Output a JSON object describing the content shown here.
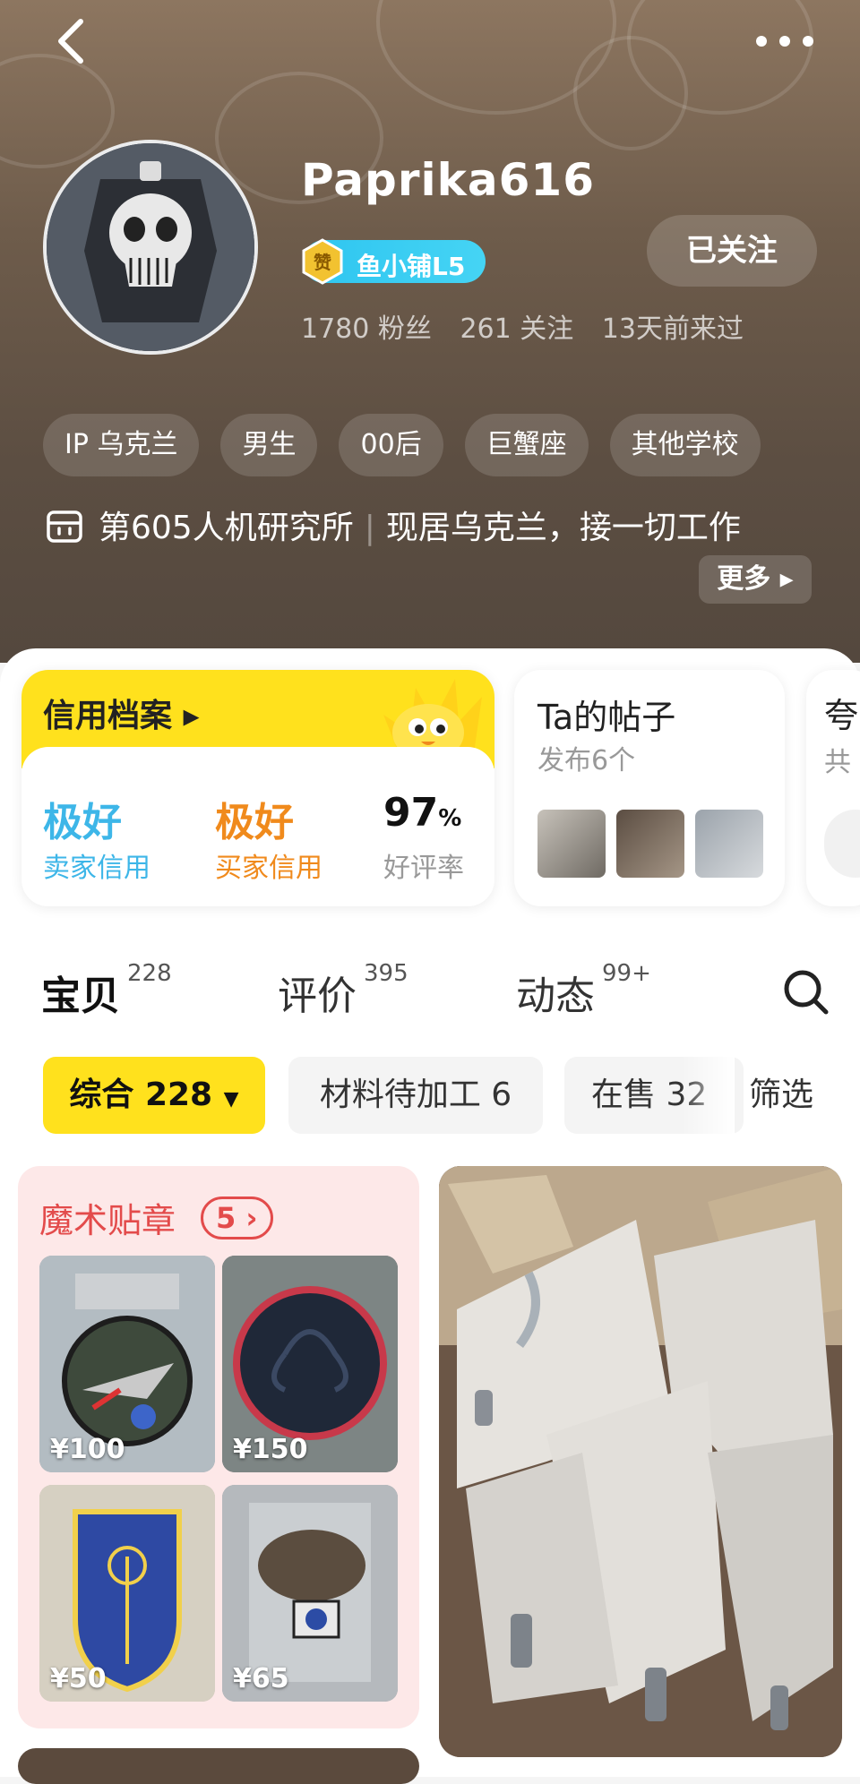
{
  "header": {
    "username": "Paprika616",
    "shop_badge": {
      "icon": "赞",
      "label": "鱼小铺L5"
    },
    "follow_label": "已关注",
    "stats": {
      "fans": "1780 粉丝",
      "following": "261 关注",
      "last_seen": "13天前来过"
    },
    "tags": [
      "IP 乌克兰",
      "男生",
      "00后",
      "巨蟹座",
      "其他学校"
    ],
    "bio": {
      "org": "第605人机研究所",
      "text": "现居乌克兰，接一切工作",
      "more_label": "更多"
    }
  },
  "credit": {
    "title": "信用档案",
    "seller": {
      "value": "极好",
      "label": "卖家信用",
      "color": "#3db6e8"
    },
    "buyer": {
      "value": "极好",
      "label": "买家信用",
      "color": "#f08a1c"
    },
    "rating": {
      "value": "97",
      "unit": "%",
      "label": "好评率"
    }
  },
  "posts": {
    "title": "Ta的帖子",
    "subtitle": "发布6个"
  },
  "third_card": {
    "title": "夸",
    "subtitle": "共"
  },
  "tabs": [
    {
      "label": "宝贝",
      "count": "228"
    },
    {
      "label": "评价",
      "count": "395"
    },
    {
      "label": "动态",
      "count": "99+"
    }
  ],
  "chips": {
    "main": "综合 228",
    "second": "材料待加工 6",
    "third": "在售 32",
    "filter": "筛选"
  },
  "collection": {
    "title": "魔术贴章",
    "count": "5",
    "items": [
      {
        "price": "¥100"
      },
      {
        "price": "¥150"
      },
      {
        "price": "¥50"
      },
      {
        "price": "¥65"
      }
    ]
  },
  "colors": {
    "accent": "#ffe11d",
    "collection_red": "#e34b4b"
  }
}
